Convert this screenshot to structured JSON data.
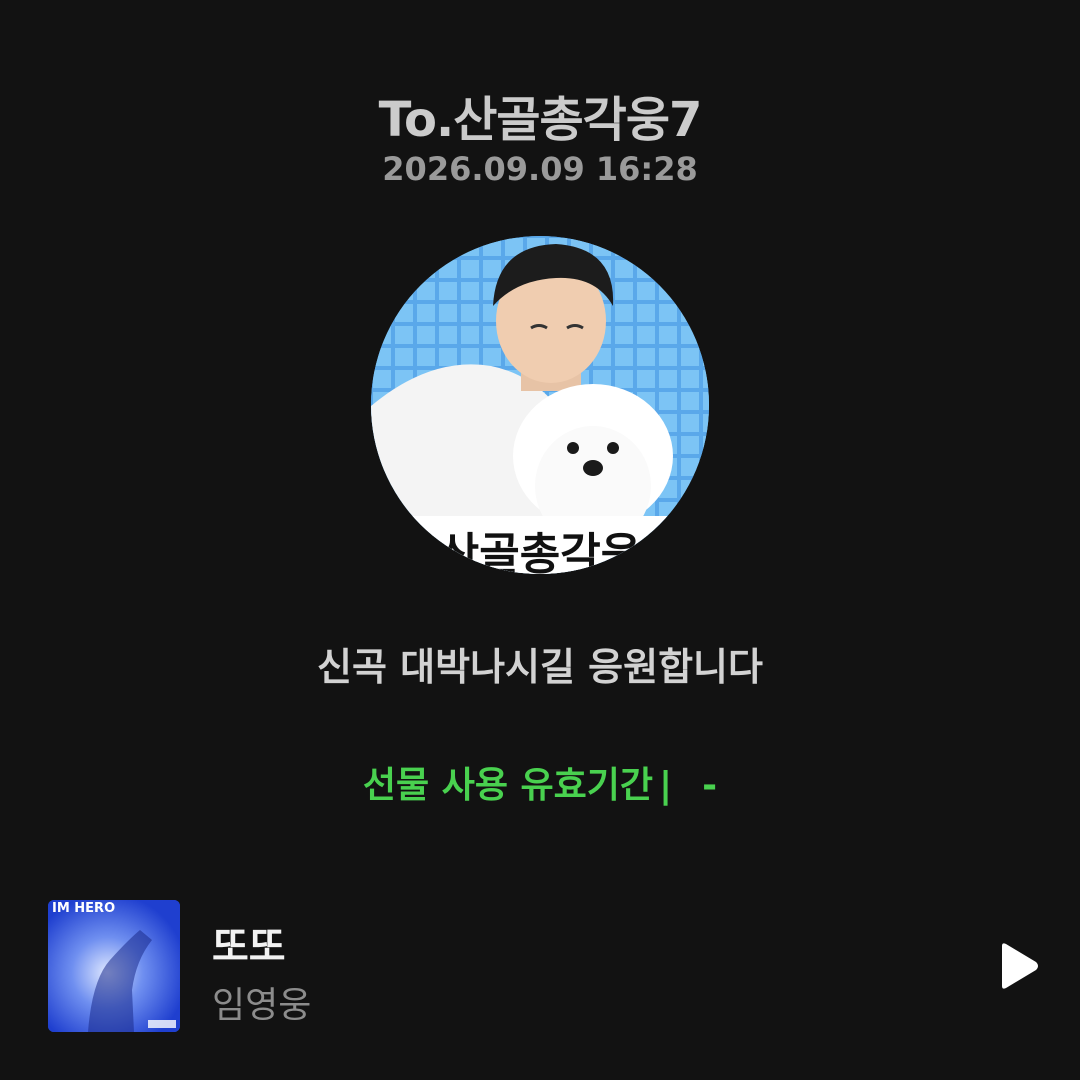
{
  "header": {
    "to_label": "To.산골총각웅7",
    "datetime": "2026.09.09 16:28"
  },
  "profile": {
    "image_icon": "profile-photo",
    "image_caption": "산골총각웅"
  },
  "message": "신곡 대박나시길 응원합니다",
  "gift": {
    "validity_label": "선물 사용 유효기간",
    "separator": "|",
    "validity_value": "-"
  },
  "track": {
    "album_art_icon": "album-cover",
    "album_art_text": "IM HERO",
    "title": "또또",
    "artist": "임영웅",
    "play_icon": "play-icon"
  },
  "colors": {
    "background": "#121212",
    "accent_green": "#49d14f",
    "primary_text": "#f2f2f2",
    "secondary_text": "#8c8c8c"
  }
}
